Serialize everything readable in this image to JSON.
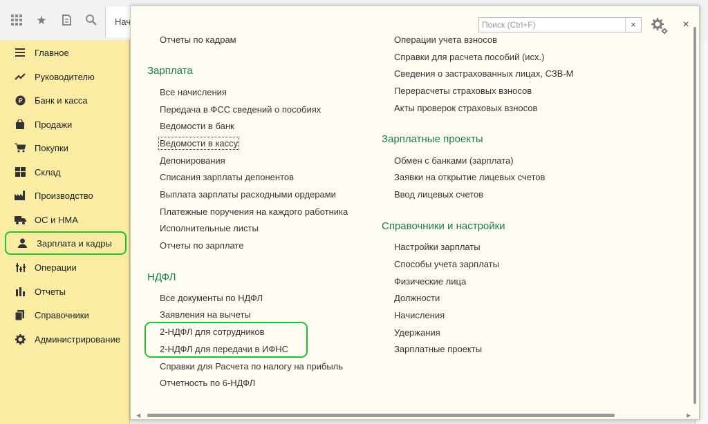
{
  "toolbar": {
    "icons": [
      "apps-grid-icon",
      "star-icon",
      "history-icon",
      "search-icon"
    ],
    "tab_label": "Нач"
  },
  "sidebar": {
    "items": [
      {
        "label": "Главное",
        "icon": "menu-lines-icon"
      },
      {
        "label": "Руководителю",
        "icon": "trend-chart-icon"
      },
      {
        "label": "Банк и касса",
        "icon": "ruble-coin-icon"
      },
      {
        "label": "Продажи",
        "icon": "shopping-bag-icon"
      },
      {
        "label": "Покупки",
        "icon": "cart-icon"
      },
      {
        "label": "Склад",
        "icon": "warehouse-icon"
      },
      {
        "label": "Производство",
        "icon": "factory-icon"
      },
      {
        "label": "ОС и НМА",
        "icon": "truck-icon"
      },
      {
        "label": "Зарплата и кадры",
        "icon": "user-icon"
      },
      {
        "label": "Операции",
        "icon": "operations-icon"
      },
      {
        "label": "Отчеты",
        "icon": "bar-chart-icon"
      },
      {
        "label": "Справочники",
        "icon": "books-icon"
      },
      {
        "label": "Администрирование",
        "icon": "gear-icon"
      }
    ],
    "active_index": 8
  },
  "panel": {
    "search_placeholder": "Поиск (Ctrl+F)",
    "search_clear": "×",
    "close": "×",
    "left_column": {
      "top_link": "Отчеты по кадрам",
      "zarplata": {
        "title": "Зарплата",
        "links": [
          "Все начисления",
          "Передача в ФСС сведений о пособиях",
          "Ведомости в банк",
          "Ведомости в кассу",
          "Депонирования",
          "Списания зарплаты депонентов",
          "Выплата зарплаты расходными ордерами",
          "Платежные поручения на каждого работника",
          "Исполнительные листы",
          "Отчеты по зарплате"
        ]
      },
      "ndfl": {
        "title": "НДФЛ",
        "links": [
          "Все документы по НДФЛ",
          "Заявления на вычеты",
          "2-НДФЛ для сотрудников",
          "2-НДФЛ для передачи в ИФНС",
          "Справки для Расчета по налогу на прибыль",
          "Отчетность по 6-НДФЛ"
        ]
      }
    },
    "right_column": {
      "top_links": [
        "Операции учета взносов",
        "Справки для расчета пособий (исх.)",
        "Сведения о застрахованных лицах, СЗВ-М",
        "Перерасчеты страховых взносов",
        "Акты проверок страховых взносов"
      ],
      "projects": {
        "title": "Зарплатные проекты",
        "links": [
          "Обмен с банками (зарплата)",
          "Заявки на открытие лицевых счетов",
          "Ввод лицевых счетов"
        ]
      },
      "settings": {
        "title": "Справочники и настройки",
        "links": [
          "Настройки зарплаты",
          "Способы учета зарплаты",
          "Физические лица",
          "Должности",
          "Начисления",
          "Удержания",
          "Зарплатные проекты"
        ]
      }
    }
  },
  "colors": {
    "sidebar_bg": "#fbeca4",
    "section_title": "#1f7a4a",
    "highlight": "#22c02a",
    "panel_bg": "#fffdf1"
  }
}
